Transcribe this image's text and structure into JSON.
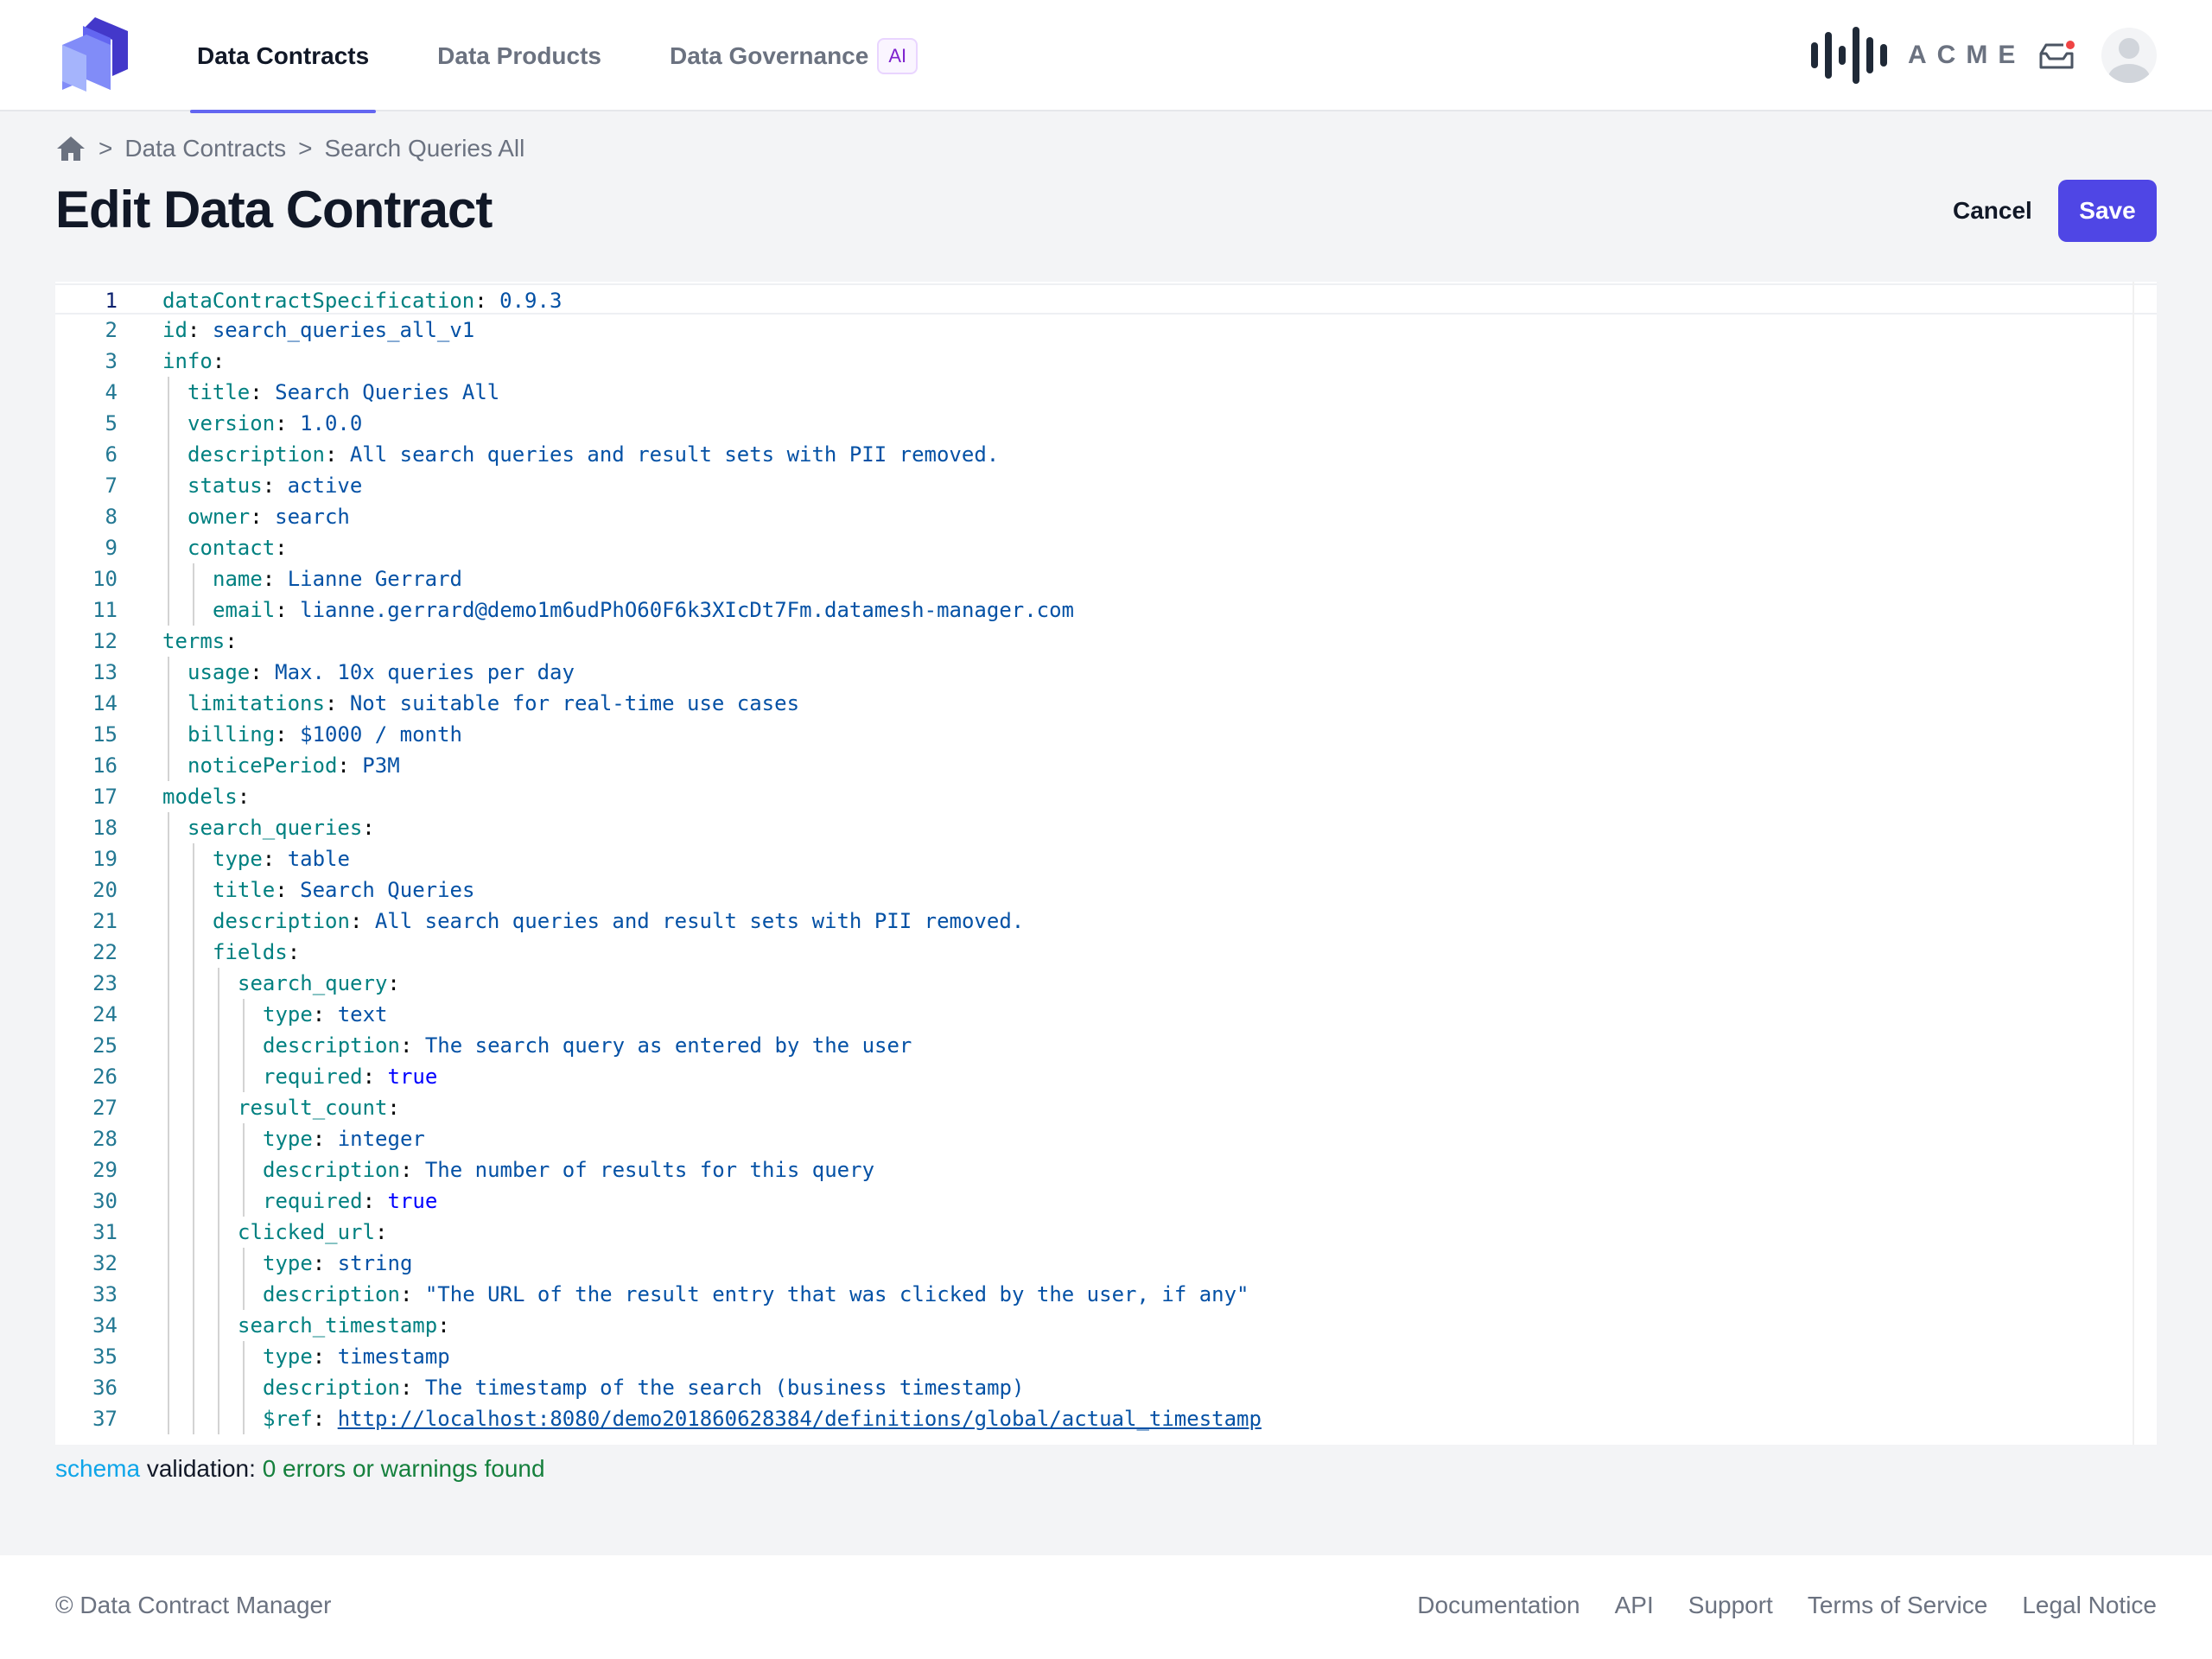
{
  "header": {
    "logo_icon": "cube-stack-logo",
    "nav": [
      {
        "label": "Data Contracts",
        "active": true
      },
      {
        "label": "Data Products",
        "active": false
      },
      {
        "label": "Data Governance",
        "active": false,
        "badge": "AI"
      }
    ],
    "org_logo_text": "ACME",
    "inbox_icon": "inbox-icon",
    "avatar_icon": "user-avatar-icon"
  },
  "breadcrumb": {
    "home_icon": "home-icon",
    "items": [
      "Data Contracts",
      "Search Queries All"
    ],
    "separator": ">"
  },
  "page": {
    "title": "Edit Data Contract",
    "cancel_label": "Cancel",
    "save_label": "Save"
  },
  "editor": {
    "lines": [
      {
        "n": "1",
        "indent": 0,
        "key": "dataContractSpecification",
        "value": "0.9.3",
        "type": "v"
      },
      {
        "n": "2",
        "indent": 0,
        "key": "id",
        "value": "search_queries_all_v1",
        "type": "v"
      },
      {
        "n": "3",
        "indent": 0,
        "key": "info",
        "value": "",
        "type": "v"
      },
      {
        "n": "4",
        "indent": 1,
        "key": "title",
        "value": "Search Queries All",
        "type": "v"
      },
      {
        "n": "5",
        "indent": 1,
        "key": "version",
        "value": "1.0.0",
        "type": "v"
      },
      {
        "n": "6",
        "indent": 1,
        "key": "description",
        "value": "All search queries and result sets with PII removed.",
        "type": "v"
      },
      {
        "n": "7",
        "indent": 1,
        "key": "status",
        "value": "active",
        "type": "v"
      },
      {
        "n": "8",
        "indent": 1,
        "key": "owner",
        "value": "search",
        "type": "v"
      },
      {
        "n": "9",
        "indent": 1,
        "key": "contact",
        "value": "",
        "type": "v"
      },
      {
        "n": "10",
        "indent": 2,
        "key": "name",
        "value": "Lianne Gerrard",
        "type": "v"
      },
      {
        "n": "11",
        "indent": 2,
        "key": "email",
        "value": "lianne.gerrard@demo1m6udPhO60F6k3XIcDt7Fm.datamesh-manager.com",
        "type": "v"
      },
      {
        "n": "12",
        "indent": 0,
        "key": "terms",
        "value": "",
        "type": "v"
      },
      {
        "n": "13",
        "indent": 1,
        "key": "usage",
        "value": "Max. 10x queries per day",
        "type": "v"
      },
      {
        "n": "14",
        "indent": 1,
        "key": "limitations",
        "value": "Not suitable for real-time use cases",
        "type": "v"
      },
      {
        "n": "15",
        "indent": 1,
        "key": "billing",
        "value": "$1000 / month",
        "type": "v"
      },
      {
        "n": "16",
        "indent": 1,
        "key": "noticePeriod",
        "value": "P3M",
        "type": "v"
      },
      {
        "n": "17",
        "indent": 0,
        "key": "models",
        "value": "",
        "type": "v"
      },
      {
        "n": "18",
        "indent": 1,
        "key": "search_queries",
        "value": "",
        "type": "v"
      },
      {
        "n": "19",
        "indent": 2,
        "key": "type",
        "value": "table",
        "type": "v"
      },
      {
        "n": "20",
        "indent": 2,
        "key": "title",
        "value": "Search Queries",
        "type": "v"
      },
      {
        "n": "21",
        "indent": 2,
        "key": "description",
        "value": "All search queries and result sets with PII removed.",
        "type": "v"
      },
      {
        "n": "22",
        "indent": 2,
        "key": "fields",
        "value": "",
        "type": "v"
      },
      {
        "n": "23",
        "indent": 3,
        "key": "search_query",
        "value": "",
        "type": "v"
      },
      {
        "n": "24",
        "indent": 4,
        "key": "type",
        "value": "text",
        "type": "v"
      },
      {
        "n": "25",
        "indent": 4,
        "key": "description",
        "value": "The search query as entered by the user",
        "type": "v"
      },
      {
        "n": "26",
        "indent": 4,
        "key": "required",
        "value": "true",
        "type": "b"
      },
      {
        "n": "27",
        "indent": 3,
        "key": "result_count",
        "value": "",
        "type": "v"
      },
      {
        "n": "28",
        "indent": 4,
        "key": "type",
        "value": "integer",
        "type": "v"
      },
      {
        "n": "29",
        "indent": 4,
        "key": "description",
        "value": "The number of results for this query",
        "type": "v"
      },
      {
        "n": "30",
        "indent": 4,
        "key": "required",
        "value": "true",
        "type": "b"
      },
      {
        "n": "31",
        "indent": 3,
        "key": "clicked_url",
        "value": "",
        "type": "v"
      },
      {
        "n": "32",
        "indent": 4,
        "key": "type",
        "value": "string",
        "type": "v"
      },
      {
        "n": "33",
        "indent": 4,
        "key": "description",
        "value": "\"The URL of the result entry that was clicked by the user, if any\"",
        "type": "v"
      },
      {
        "n": "34",
        "indent": 3,
        "key": "search_timestamp",
        "value": "",
        "type": "v"
      },
      {
        "n": "35",
        "indent": 4,
        "key": "type",
        "value": "timestamp",
        "type": "v"
      },
      {
        "n": "36",
        "indent": 4,
        "key": "description",
        "value": "The timestamp of the search (business timestamp)",
        "type": "v"
      },
      {
        "n": "37",
        "indent": 4,
        "key": "$ref",
        "value": "http://localhost:8080/demo201860628384/definitions/global/actual_timestamp",
        "type": "u"
      }
    ],
    "current_line": 1
  },
  "validation": {
    "schema_link": "schema",
    "label": "validation:",
    "result": "0 errors or warnings found"
  },
  "footer": {
    "copyright": "© Data Contract Manager",
    "links": [
      "Documentation",
      "API",
      "Support",
      "Terms of Service",
      "Legal Notice"
    ]
  },
  "colors": {
    "primary": "#4f46e5",
    "nav_indicator": "#6366f1",
    "yaml_key": "#008080",
    "yaml_value": "#0451a5",
    "yaml_bool": "#0000ff",
    "validation_ok": "#15803d"
  }
}
